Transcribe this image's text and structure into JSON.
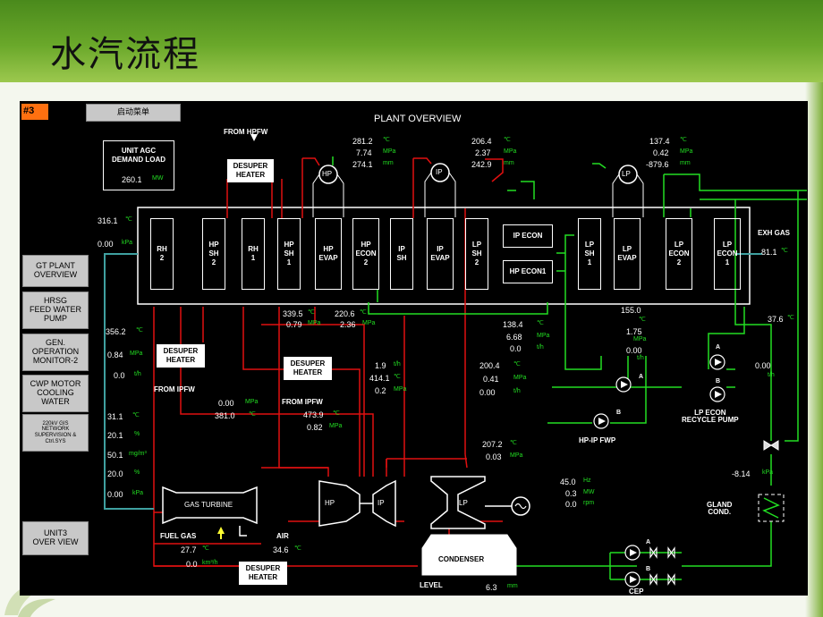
{
  "slide": {
    "title": "水汽流程"
  },
  "unit_badge": "#3",
  "start_menu": "启动菜单",
  "plant_title": "PLANT OVERVIEW",
  "agc": {
    "label": "UNIT AGC\nDEMAND LOAD",
    "value": "260.1",
    "unit": "MW"
  },
  "nav": {
    "gt": "GT PLANT\nOVERVIEW",
    "hrsg": "HRSG\nFEED WATER\nPUMP",
    "gen": "GEN.\nOPERATION\nMONITOR-2",
    "cwp": "CWP MOTOR\nCOOLING\nWATER",
    "net": "220kV GIS\nNETWORK\nSUPERVISION &\nCtrl.SYS",
    "unit3": "UNIT3\nOVER VIEW"
  },
  "labels": {
    "from_hpfw": "FROM HPFW",
    "from_ipfw_1": "FROM IPFW",
    "from_ipfw_2": "FROM IPFW",
    "desuper": "DESUPER\nHEATER",
    "exh_gas": "EXH GAS",
    "hp_ip_fwp": "HP-IP FWP",
    "lp_econ_pump": "LP ECON\nRECYCLE PUMP",
    "gland": "GLAND\nCOND.",
    "fuel_gas": "FUEL GAS",
    "air": "AIR",
    "level": "LEVEL",
    "cep": "CEP",
    "gas_turbine": "GAS TURBINE",
    "hp": "HP",
    "ip": "IP",
    "lp": "LP",
    "condenser": "CONDENSER",
    "ip_econ": "IP ECON",
    "hp_econ1": "HP ECON1",
    "pump_a": "A",
    "pump_b": "B"
  },
  "modules": [
    "RH\n2",
    "HP\nSH\n2",
    "RH\n1",
    "HP\nSH\n1",
    "HP\nEVAP",
    "HP\nECON\n2",
    "IP\nSH",
    "IP\nEVAP",
    "LP\nSH\n2",
    "LP\nSH\n1",
    "LP\nEVAP",
    "LP\nECON\n2",
    "LP\nECON\n1"
  ],
  "drums": {
    "hp": "HP",
    "ip": "IP",
    "lp": "LP"
  },
  "readings": {
    "hp_drum": {
      "t": "281.2",
      "p": "7.74",
      "l": "274.1"
    },
    "ip_drum": {
      "t": "206.4",
      "p": "2.37",
      "l": "242.9"
    },
    "lp_drum": {
      "t": "137.4",
      "p": "0.42",
      "l": "-879.6"
    },
    "inlet_t": "316.1",
    "inlet_p": "0.00",
    "exh": "81.1",
    "rh_out_t": "339.5",
    "rh_out_p": "0.79",
    "ip_out_t": "220.6",
    "ip_out_p": "2.36",
    "left_t": "356.2",
    "left_p": "0.84",
    "left_f": "0.0",
    "ipecon_t": "138.4",
    "ipecon_p": "6.68",
    "ipecon_f": "0.0",
    "hpecon_t": "155.0",
    "hpecon_p": "1.75",
    "hpecon_f": "0.00",
    "ip2_t": "200.4",
    "ip2_p": "0.41",
    "ip2_f": "0.00",
    "desup_f": "1.9",
    "desup_t": "414.1",
    "desup_p": "0.2",
    "mid_p": "0.00",
    "mid_t": "381.0",
    "ip_fw_t": "473.9",
    "ip_fw_p": "0.82",
    "amb_t": "31.1",
    "amb_h": "20.1",
    "amb_c": "50.1",
    "amb_pct": "20.0",
    "amb_p": "0.00",
    "lp_in_t": "207.2",
    "lp_in_p": "0.03",
    "gen_hz": "45.0",
    "gen_mw": "0.3",
    "gen_rpm": "0.0",
    "fuel_t": "27.7",
    "fuel_f": "0.0",
    "air_t": "34.6",
    "level": "6.3",
    "lp_econ_t": "37.6",
    "lp_recycle_f": "0.00",
    "gland_p": "-8.14"
  },
  "units": {
    "c": "℃",
    "mpa": "MPa",
    "kpa": "kPa",
    "mm": "mm",
    "th": "t/h",
    "pct": "%",
    "mgm3": "mg/m³",
    "hz": "Hz",
    "mw": "MW",
    "rpm": "rpm",
    "km3h": "km³/h"
  }
}
